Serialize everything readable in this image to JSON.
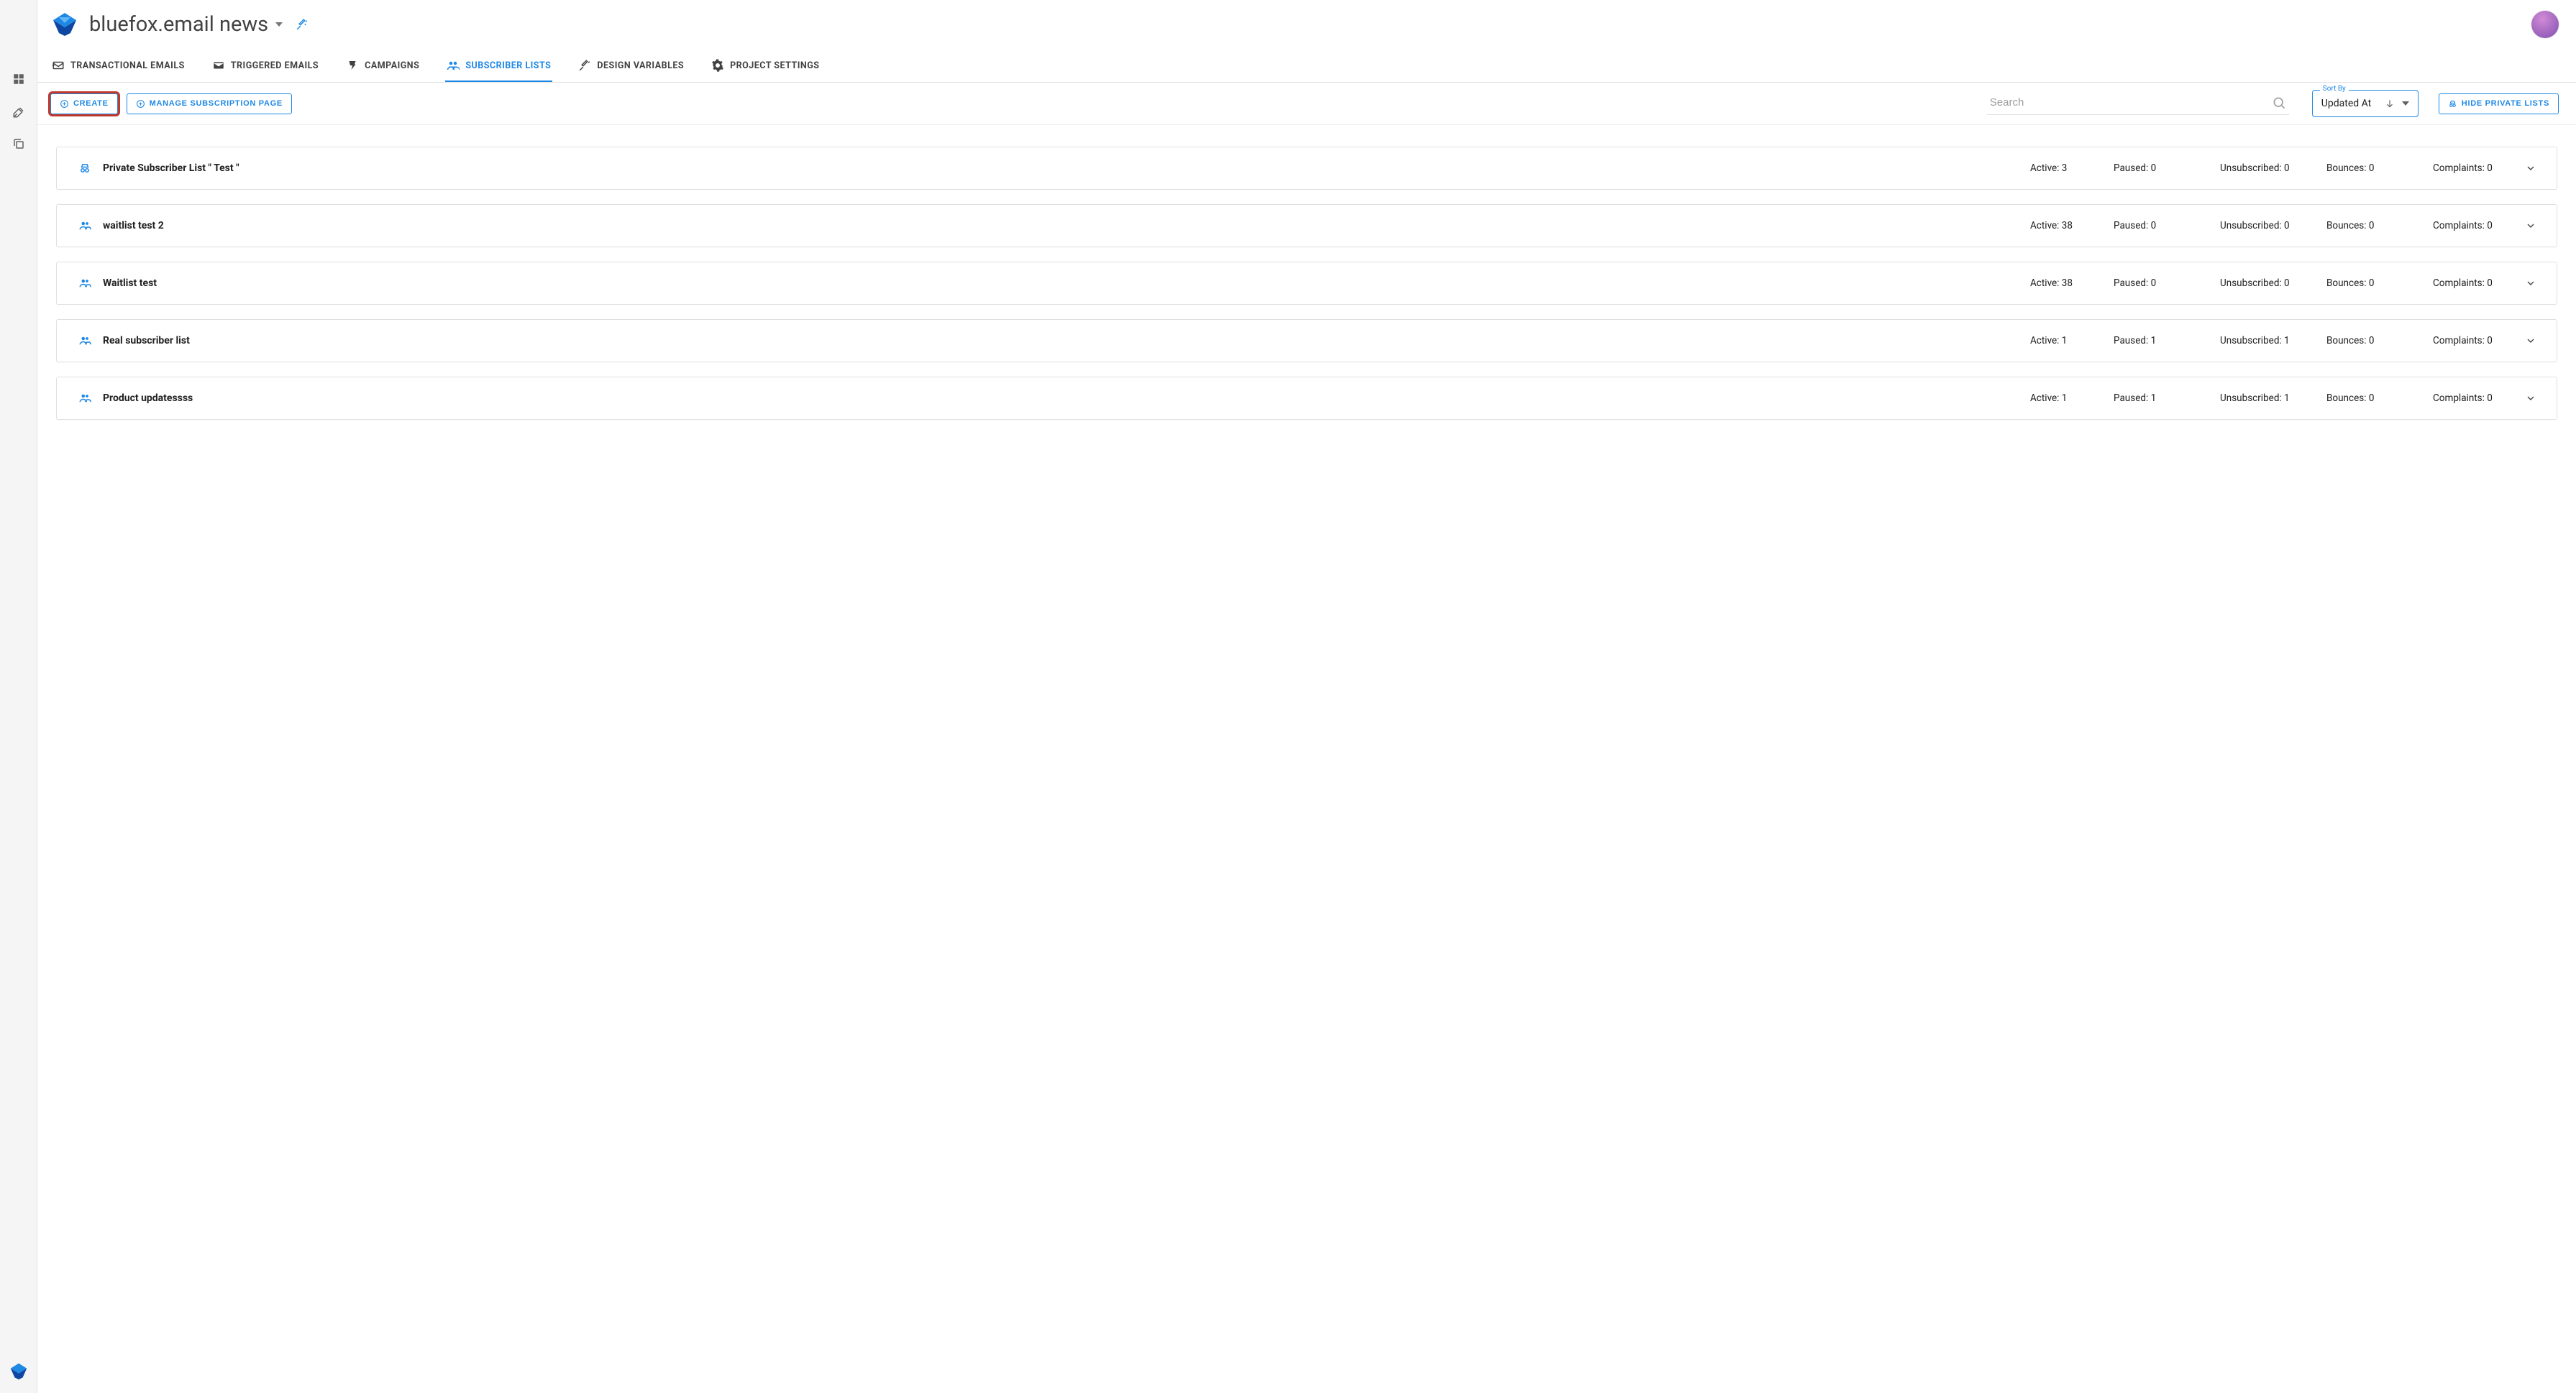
{
  "header": {
    "project_title": "bluefox.email news"
  },
  "tabs": [
    {
      "label": "TRANSACTIONAL EMAILS",
      "active": false
    },
    {
      "label": "TRIGGERED EMAILS",
      "active": false
    },
    {
      "label": "CAMPAIGNS",
      "active": false
    },
    {
      "label": "SUBSCRIBER LISTS",
      "active": true
    },
    {
      "label": "DESIGN VARIABLES",
      "active": false
    },
    {
      "label": "PROJECT SETTINGS",
      "active": false
    }
  ],
  "toolbar": {
    "create_label": "CREATE",
    "manage_label": "MANAGE SUBSCRIPTION PAGE",
    "search_placeholder": "Search",
    "sort_by_label": "Sort By",
    "sort_value": "Updated At",
    "hide_private_label": "HIDE PRIVATE LISTS"
  },
  "stat_labels": {
    "active": "Active",
    "paused": "Paused",
    "unsubscribed": "Unsubscribed",
    "bounces": "Bounces",
    "complaints": "Complaints"
  },
  "lists": [
    {
      "name": "Private Subscriber List \" Test \"",
      "private": true,
      "active": 3,
      "paused": 0,
      "unsubscribed": 0,
      "bounces": 0,
      "complaints": 0
    },
    {
      "name": "waitlist test 2",
      "private": false,
      "active": 38,
      "paused": 0,
      "unsubscribed": 0,
      "bounces": 0,
      "complaints": 0
    },
    {
      "name": "Waitlist test",
      "private": false,
      "active": 38,
      "paused": 0,
      "unsubscribed": 0,
      "bounces": 0,
      "complaints": 0
    },
    {
      "name": "Real subscriber list",
      "private": false,
      "active": 1,
      "paused": 1,
      "unsubscribed": 1,
      "bounces": 0,
      "complaints": 0
    },
    {
      "name": "Product updatessss",
      "private": false,
      "active": 1,
      "paused": 1,
      "unsubscribed": 1,
      "bounces": 0,
      "complaints": 0
    }
  ]
}
